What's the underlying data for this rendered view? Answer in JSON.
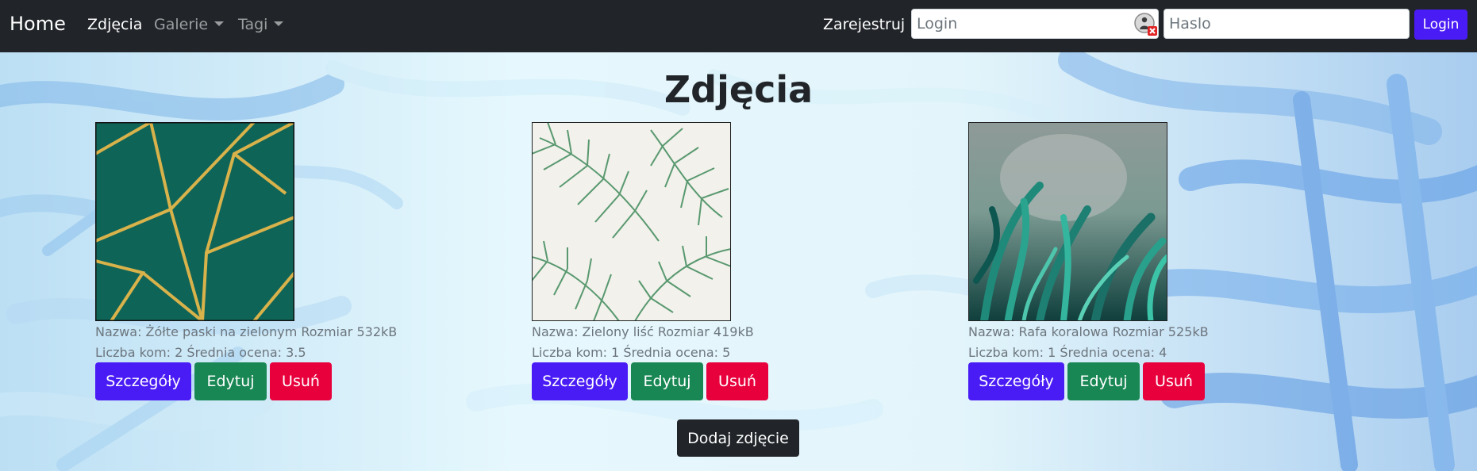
{
  "nav": {
    "brand": "Home",
    "items": [
      {
        "label": "Zdjęcia",
        "active": true
      },
      {
        "label": "Galerie",
        "dropdown": true
      },
      {
        "label": "Tagi",
        "dropdown": true
      }
    ],
    "register": "Zarejestruj",
    "login_placeholder": "Login",
    "password_placeholder": "Haslo",
    "login_button": "Login"
  },
  "page_title": "Zdjęcia",
  "photos": [
    {
      "name_line": "Nazwa: Żółte paski na zielonym Rozmiar 532kB",
      "stats_line": "Liczba kom: 2 Średnia ocena: 3.5",
      "image": "green-gold-geometric"
    },
    {
      "name_line": "Nazwa: Zielony liść Rozmiar 419kB",
      "stats_line": "Liczba kom: 1 Średnia ocena: 5",
      "image": "palm-leaves"
    },
    {
      "name_line": "Nazwa: Rafa koralowa Rozmiar 525kB",
      "stats_line": "Liczba kom: 1 Średnia ocena: 4",
      "image": "tropical-plants"
    }
  ],
  "buttons": {
    "details": "Szczegóły",
    "edit": "Edytuj",
    "delete": "Usuń"
  },
  "add_button": "Dodaj zdjęcie",
  "colors": {
    "navbar": "#212529",
    "primary": "#4a1cf5",
    "success": "#198754",
    "danger": "#e8003d"
  }
}
